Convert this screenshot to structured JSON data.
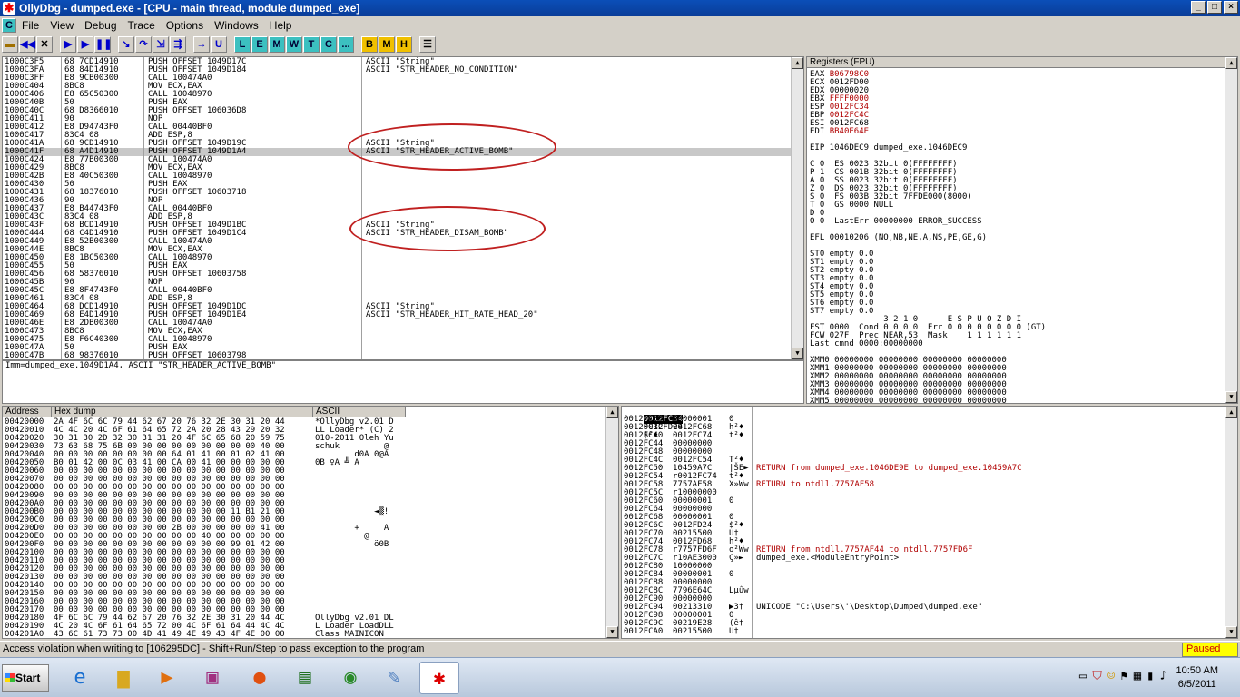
{
  "window": {
    "title": "OllyDbg - dumped.exe - [CPU - main thread, module dumped_exe]"
  },
  "menu": [
    "File",
    "View",
    "Debug",
    "Trace",
    "Options",
    "Windows",
    "Help"
  ],
  "toolbar": {
    "letters": [
      "L",
      "E",
      "M",
      "W",
      "T",
      "C",
      "...",
      "B",
      "M",
      "H"
    ]
  },
  "disasm": [
    [
      "1000C3F5",
      "68 7CD14910",
      "PUSH OFFSET 1049D17C",
      "ASCII \"String\""
    ],
    [
      "1000C3FA",
      "68 84D14910",
      "PUSH OFFSET 1049D184",
      "ASCII \"STR_HEADER_NO_CONDITION\""
    ],
    [
      "1000C3FF",
      "E8 9CB00300",
      "CALL 100474A0",
      ""
    ],
    [
      "1000C404",
      "8BC8",
      "MOV ECX,EAX",
      ""
    ],
    [
      "1000C406",
      "E8 65C50300",
      "CALL 10048970",
      ""
    ],
    [
      "1000C40B",
      "50",
      "PUSH EAX",
      ""
    ],
    [
      "1000C40C",
      "68 D8366010",
      "PUSH OFFSET 106036D8",
      ""
    ],
    [
      "1000C411",
      "90",
      "NOP",
      ""
    ],
    [
      "1000C412",
      "E8 D94743F0",
      "CALL 00440BF0",
      ""
    ],
    [
      "1000C417",
      "83C4 08",
      "ADD ESP,8",
      ""
    ],
    [
      "1000C41A",
      "68 9CD14910",
      "PUSH OFFSET 1049D19C",
      "ASCII \"String\""
    ],
    [
      "1000C41F",
      "68 A4D14910",
      "PUSH OFFSET 1049D1A4",
      "ASCII \"STR_HEADER_ACTIVE_BOMB\""
    ],
    [
      "1000C424",
      "E8 77B00300",
      "CALL 100474A0",
      ""
    ],
    [
      "1000C429",
      "8BC8",
      "MOV ECX,EAX",
      ""
    ],
    [
      "1000C42B",
      "E8 40C50300",
      "CALL 10048970",
      ""
    ],
    [
      "1000C430",
      "50",
      "PUSH EAX",
      ""
    ],
    [
      "1000C431",
      "68 18376010",
      "PUSH OFFSET 10603718",
      ""
    ],
    [
      "1000C436",
      "90",
      "NOP",
      ""
    ],
    [
      "1000C437",
      "E8 B44743F0",
      "CALL 00440BF0",
      ""
    ],
    [
      "1000C43C",
      "83C4 08",
      "ADD ESP,8",
      ""
    ],
    [
      "1000C43F",
      "68 BCD14910",
      "PUSH OFFSET 1049D1BC",
      "ASCII \"String\""
    ],
    [
      "1000C444",
      "68 C4D14910",
      "PUSH OFFSET 1049D1C4",
      "ASCII \"STR_HEADER_DISAM_BOMB\""
    ],
    [
      "1000C449",
      "E8 52B00300",
      "CALL 100474A0",
      ""
    ],
    [
      "1000C44E",
      "8BC8",
      "MOV ECX,EAX",
      ""
    ],
    [
      "1000C450",
      "E8 1BC50300",
      "CALL 10048970",
      ""
    ],
    [
      "1000C455",
      "50",
      "PUSH EAX",
      ""
    ],
    [
      "1000C456",
      "68 58376010",
      "PUSH OFFSET 10603758",
      ""
    ],
    [
      "1000C45B",
      "90",
      "NOP",
      ""
    ],
    [
      "1000C45C",
      "E8 8F4743F0",
      "CALL 00440BF0",
      ""
    ],
    [
      "1000C461",
      "83C4 08",
      "ADD ESP,8",
      ""
    ],
    [
      "1000C464",
      "68 DCD14910",
      "PUSH OFFSET 1049D1DC",
      "ASCII \"String\""
    ],
    [
      "1000C469",
      "68 E4D14910",
      "PUSH OFFSET 1049D1E4",
      "ASCII \"STR_HEADER_HIT_RATE_HEAD_20\""
    ],
    [
      "1000C46E",
      "E8 2DB00300",
      "CALL 100474A0",
      ""
    ],
    [
      "1000C473",
      "8BC8",
      "MOV ECX,EAX",
      ""
    ],
    [
      "1000C475",
      "E8 F6C40300",
      "CALL 10048970",
      ""
    ],
    [
      "1000C47A",
      "50",
      "PUSH EAX",
      ""
    ],
    [
      "1000C47B",
      "68 98376010",
      "PUSH OFFSET 10603798",
      ""
    ]
  ],
  "info_line": "Imm=dumped_exe.1049D1A4, ASCII \"STR_HEADER_ACTIVE_BOMB\"",
  "registers": {
    "header": "Registers (FPU)",
    "lines": [
      [
        "EAX",
        "B06798C0",
        "",
        true
      ],
      [
        "ECX",
        "0012FD00",
        "",
        false
      ],
      [
        "EDX",
        "00000020",
        "",
        false
      ],
      [
        "EBX",
        "FFFF0000",
        "",
        true
      ],
      [
        "ESP",
        "0012FC34",
        "",
        true
      ],
      [
        "EBP",
        "0012FC4C",
        "",
        true
      ],
      [
        "ESI",
        "0012FC68",
        "",
        false
      ],
      [
        "EDI",
        "BB40E64E",
        "",
        true
      ]
    ],
    "eip": "EIP 1046DEC9 dumped_exe.1046DEC9",
    "flags": [
      "C 0  ES 0023 32bit 0(FFFFFFFF)",
      "P 1  CS 001B 32bit 0(FFFFFFFF)",
      "A 0  SS 0023 32bit 0(FFFFFFFF)",
      "Z 0  DS 0023 32bit 0(FFFFFFFF)",
      "S 0  FS 003B 32bit 7FFDE000(8000)",
      "T 0  GS 0000 NULL",
      "D 0",
      "O 0  LastErr 00000000 ERROR_SUCCESS"
    ],
    "efl": "EFL 00010206 (NO,NB,NE,A,NS,PE,GE,G)",
    "st": [
      "ST0 empty 0.0",
      "ST1 empty 0.0",
      "ST2 empty 0.0",
      "ST3 empty 0.0",
      "ST4 empty 0.0",
      "ST5 empty 0.0",
      "ST6 empty 0.0",
      "ST7 empty 0.0"
    ],
    "fpu_hdr": "               3 2 1 0      E S P U O Z D I",
    "fst": "FST 0000  Cond 0 0 0 0  Err 0 0 0 0 0 0 0 0 (GT)",
    "fcw": "FCW 027F  Prec NEAR,53  Mask    1 1 1 1 1 1",
    "lastcmnd": "Last cmnd 0000:00000000",
    "xmm": [
      "XMM0 00000000 00000000 00000000 00000000",
      "XMM1 00000000 00000000 00000000 00000000",
      "XMM2 00000000 00000000 00000000 00000000",
      "XMM3 00000000 00000000 00000000 00000000",
      "XMM4 00000000 00000000 00000000 00000000",
      "XMM5 00000000 00000000 00000000 00000000",
      "XMM6 00000000 00000000 00000000 00000000",
      "XMM7 00000000 00000000 00000000 00000000"
    ]
  },
  "dump": {
    "headers": [
      "Address",
      "Hex dump",
      "ASCII"
    ],
    "rows": [
      [
        "00420000",
        "2A 4F 6C 6C 79 44 62 67 20 76 32 2E 30 31 20 44",
        "*OllyDbg v2.01 D"
      ],
      [
        "00420010",
        "4C 4C 20 4C 6F 61 64 65 72 2A 20 28 43 29 20 32",
        "LL Loader* (C) 2"
      ],
      [
        "00420020",
        "30 31 30 2D 32 30 31 31 20 4F 6C 65 68 20 59 75",
        "010-2011 Oleh Yu"
      ],
      [
        "00420030",
        "73 63 68 75 6B 00 00 00 00 00 00 00 00 00 40 00",
        "schuk         @"
      ],
      [
        "00420040",
        "00 00 00 00 00 00 00 00 64 01 41 00 01 02 41 00",
        "        d0A 0@A"
      ],
      [
        "00420050",
        "B0 01 42 00 0C 03 41 00 CA 00 41 00 00 00 00 00",
        "0B ♀A ╩ A"
      ],
      [
        "00420060",
        "00 00 00 00 00 00 00 00 00 00 00 00 00 00 00 00",
        ""
      ],
      [
        "00420070",
        "00 00 00 00 00 00 00 00 00 00 00 00 00 00 00 00",
        ""
      ],
      [
        "00420080",
        "00 00 00 00 00 00 00 00 00 00 00 00 00 00 00 00",
        ""
      ],
      [
        "00420090",
        "00 00 00 00 00 00 00 00 00 00 00 00 00 00 00 00",
        ""
      ],
      [
        "004200A0",
        "00 00 00 00 00 00 00 00 00 00 00 00 00 00 00 00",
        ""
      ],
      [
        "004200B0",
        "00 00 00 00 00 00 00 00 00 00 00 00 11 B1 21 00",
        "            ◄▒!"
      ],
      [
        "004200C0",
        "00 00 00 00 00 00 00 00 00 00 00 00 00 00 00 00",
        ""
      ],
      [
        "004200D0",
        "00 00 00 00 00 00 00 00 2B 00 00 00 00 00 41 00",
        "        +     A"
      ],
      [
        "004200E0",
        "00 00 00 00 00 00 00 00 00 00 40 00 00 00 00 00",
        "          @"
      ],
      [
        "004200F0",
        "00 00 00 00 00 00 00 00 00 00 00 00 99 01 42 00",
        "            ö0B"
      ],
      [
        "00420100",
        "00 00 00 00 00 00 00 00 00 00 00 00 00 00 00 00",
        ""
      ],
      [
        "00420110",
        "00 00 00 00 00 00 00 00 00 00 00 00 00 00 00 00",
        ""
      ],
      [
        "00420120",
        "00 00 00 00 00 00 00 00 00 00 00 00 00 00 00 00",
        ""
      ],
      [
        "00420130",
        "00 00 00 00 00 00 00 00 00 00 00 00 00 00 00 00",
        ""
      ],
      [
        "00420140",
        "00 00 00 00 00 00 00 00 00 00 00 00 00 00 00 00",
        ""
      ],
      [
        "00420150",
        "00 00 00 00 00 00 00 00 00 00 00 00 00 00 00 00",
        ""
      ],
      [
        "00420160",
        "00 00 00 00 00 00 00 00 00 00 00 00 00 00 00 00",
        ""
      ],
      [
        "00420170",
        "00 00 00 00 00 00 00 00 00 00 00 00 00 00 00 00",
        ""
      ],
      [
        "00420180",
        "4F 6C 6C 79 44 62 67 20 76 32 2E 30 31 20 44 4C",
        "OllyDbg v2.01 DL"
      ],
      [
        "00420190",
        "4C 20 4C 6F 61 64 65 72 00 4C 6F 61 64 44 4C 4C",
        "L Loader LoadDLL"
      ],
      [
        "004201A0",
        "43 6C 61 73 73 00 4D 41 49 4E 49 43 4F 4E 00 00",
        "Class MAINICON"
      ]
    ]
  },
  "stack": {
    "header_addr": "0012FC34",
    "header_val": "0012FD24",
    "header_ascii": "$²♦",
    "rows": [
      [
        "0012FC38",
        "00000001",
        "0",
        ""
      ],
      [
        "0012FC3C",
        "0012FC68",
        "h²♦",
        ""
      ],
      [
        "0012FC40",
        "0012FC74",
        "t²♦",
        ""
      ],
      [
        "0012FC44",
        "00000000",
        "",
        ""
      ],
      [
        "0012FC48",
        "00000000",
        "",
        ""
      ],
      [
        "0012FC4C",
        "0012FC54",
        "T²♦",
        ""
      ],
      [
        "0012FC50",
        "10459A7C",
        "|ŠE►",
        "RETURN from dumped_exe.1046DE9E to dumped_exe.10459A7C"
      ],
      [
        "0012FC54",
        "r0012FC74",
        "t²♦",
        ""
      ],
      [
        "0012FC58",
        "7757AF58",
        "X»Ww",
        "RETURN to ntdll.7757AF58"
      ],
      [
        "0012FC5C",
        "r10000000",
        "",
        ""
      ],
      [
        "0012FC60",
        "00000001",
        "0",
        ""
      ],
      [
        "0012FC64",
        "00000000",
        "",
        ""
      ],
      [
        "0012FC68",
        "00000001",
        "0",
        ""
      ],
      [
        "0012FC6C",
        "0012FD24",
        "$²♦",
        ""
      ],
      [
        "0012FC70",
        "00215500",
        "U†",
        ""
      ],
      [
        "0012FC74",
        "0012FD68",
        "h²♦",
        ""
      ],
      [
        "0012FC78",
        "r7757FD6F",
        "o²Ww",
        "RETURN from ntdll.7757AF44 to ntdll.7757FD6F"
      ],
      [
        "0012FC7C",
        "r10AE3000",
        "Ç»►",
        "dumped_exe.<ModuleEntryPoint>"
      ],
      [
        "0012FC80",
        "10000000",
        "",
        ""
      ],
      [
        "0012FC84",
        "00000001",
        "0",
        ""
      ],
      [
        "0012FC88",
        "00000000",
        "",
        ""
      ],
      [
        "0012FC8C",
        "7796E64C",
        "Lµûw",
        ""
      ],
      [
        "0012FC90",
        "00000000",
        "",
        ""
      ],
      [
        "0012FC94",
        "00213310",
        "▶3†",
        "UNICODE \"C:\\Users\\'\\Desktop\\Dumped\\dumped.exe\""
      ],
      [
        "0012FC98",
        "00000001",
        "0",
        ""
      ],
      [
        "0012FC9C",
        "00219E28",
        "(ê†",
        ""
      ],
      [
        "0012FCA0",
        "00215500",
        "U†",
        ""
      ]
    ]
  },
  "status": {
    "message": "Access violation when writing to [106295DC] - Shift+Run/Step to pass exception to the program",
    "state": "Paused"
  },
  "taskbar": {
    "start": "Start",
    "time": "10:50 AM",
    "date": "6/5/2011"
  }
}
